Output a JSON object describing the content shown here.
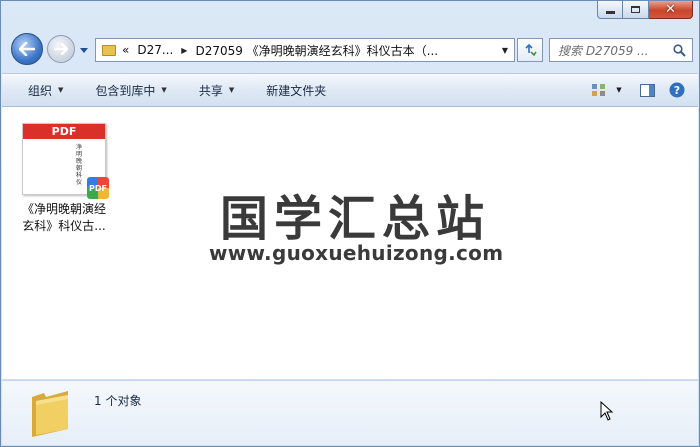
{
  "window": {
    "controls": {
      "minimize": "minimize",
      "maximize": "maximize",
      "close": "close"
    }
  },
  "nav": {
    "addr_prefix": "«",
    "breadcrumb": [
      "D27...",
      "D27059 《净明晚朝演经玄科》科仪古本（..."
    ],
    "search_placeholder": "搜索 D27059 ..."
  },
  "toolbar": {
    "items": [
      "组织",
      "包含到库中",
      "共享",
      "新建文件夹"
    ]
  },
  "content": {
    "file": {
      "thumb_header": "PDF",
      "thumb_text": "净明晚朝科仪",
      "badge": "PDF",
      "name_line1": "《净明晚朝演经",
      "name_line2": "玄科》科仪古..."
    },
    "watermark_title": "国学汇总站",
    "watermark_url": "www.guoxuehuizong.com"
  },
  "details": {
    "count": "1 个对象"
  },
  "colors": {
    "frame": "#cfe0f3",
    "pdf_red": "#d9302a",
    "folder": "#e8c24e"
  }
}
